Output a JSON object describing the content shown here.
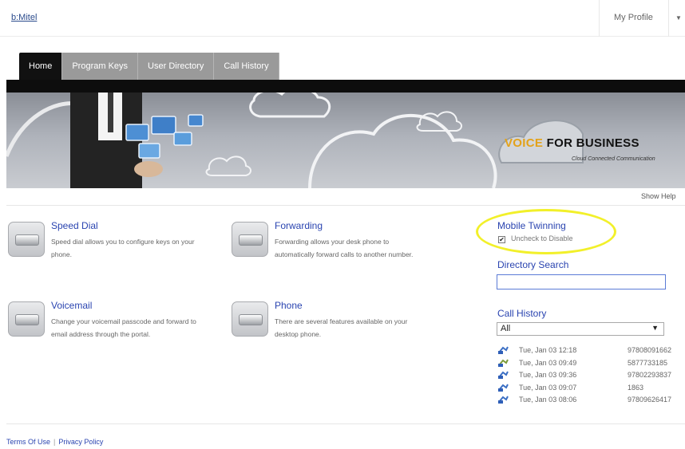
{
  "header": {
    "logo_text": "b:Mitel",
    "profile_label": "My Profile"
  },
  "tabs": [
    {
      "label": "Home",
      "active": true
    },
    {
      "label": "Program Keys",
      "active": false
    },
    {
      "label": "User Directory",
      "active": false
    },
    {
      "label": "Call History",
      "active": false
    }
  ],
  "banner": {
    "brand_accent": "VOICE",
    "brand_main": "FOR BUSINESS",
    "tagline": "Cloud Connected Communication"
  },
  "show_help": "Show Help",
  "features": [
    {
      "title": "Speed Dial",
      "description": "Speed dial allows you to configure keys on your phone."
    },
    {
      "title": "Forwarding",
      "description": "Forwarding allows your desk phone to automatically forward calls to another number."
    },
    {
      "title": "Voicemail",
      "description": "Change your voicemail passcode and forward to email address through the portal."
    },
    {
      "title": "Phone",
      "description": "There are several features available on your desktop phone."
    }
  ],
  "mobile_twinning": {
    "title": "Mobile Twinning",
    "checkbox_label": "Uncheck to Disable",
    "checked": true
  },
  "directory_search": {
    "title": "Directory Search",
    "value": "",
    "placeholder": ""
  },
  "call_history": {
    "title": "Call History",
    "filter_selected": "All",
    "entries": [
      {
        "date": "Tue, Jan 03 12:18",
        "number": "97808091662"
      },
      {
        "date": "Tue, Jan 03 09:49",
        "number": "5877733185"
      },
      {
        "date": "Tue, Jan 03 09:36",
        "number": "97802293837"
      },
      {
        "date": "Tue, Jan 03 09:07",
        "number": "1863"
      },
      {
        "date": "Tue, Jan 03 08:06",
        "number": "97809626417"
      }
    ]
  },
  "footer": {
    "terms_label": "Terms Of Use",
    "separator": "|",
    "privacy_label": "Privacy Policy"
  },
  "colors": {
    "link": "#2a44b0",
    "tab_active": "#111111",
    "tab_inactive": "#9a9a9a",
    "highlight": "#f2f02a",
    "brand_accent": "#e3a21a"
  }
}
